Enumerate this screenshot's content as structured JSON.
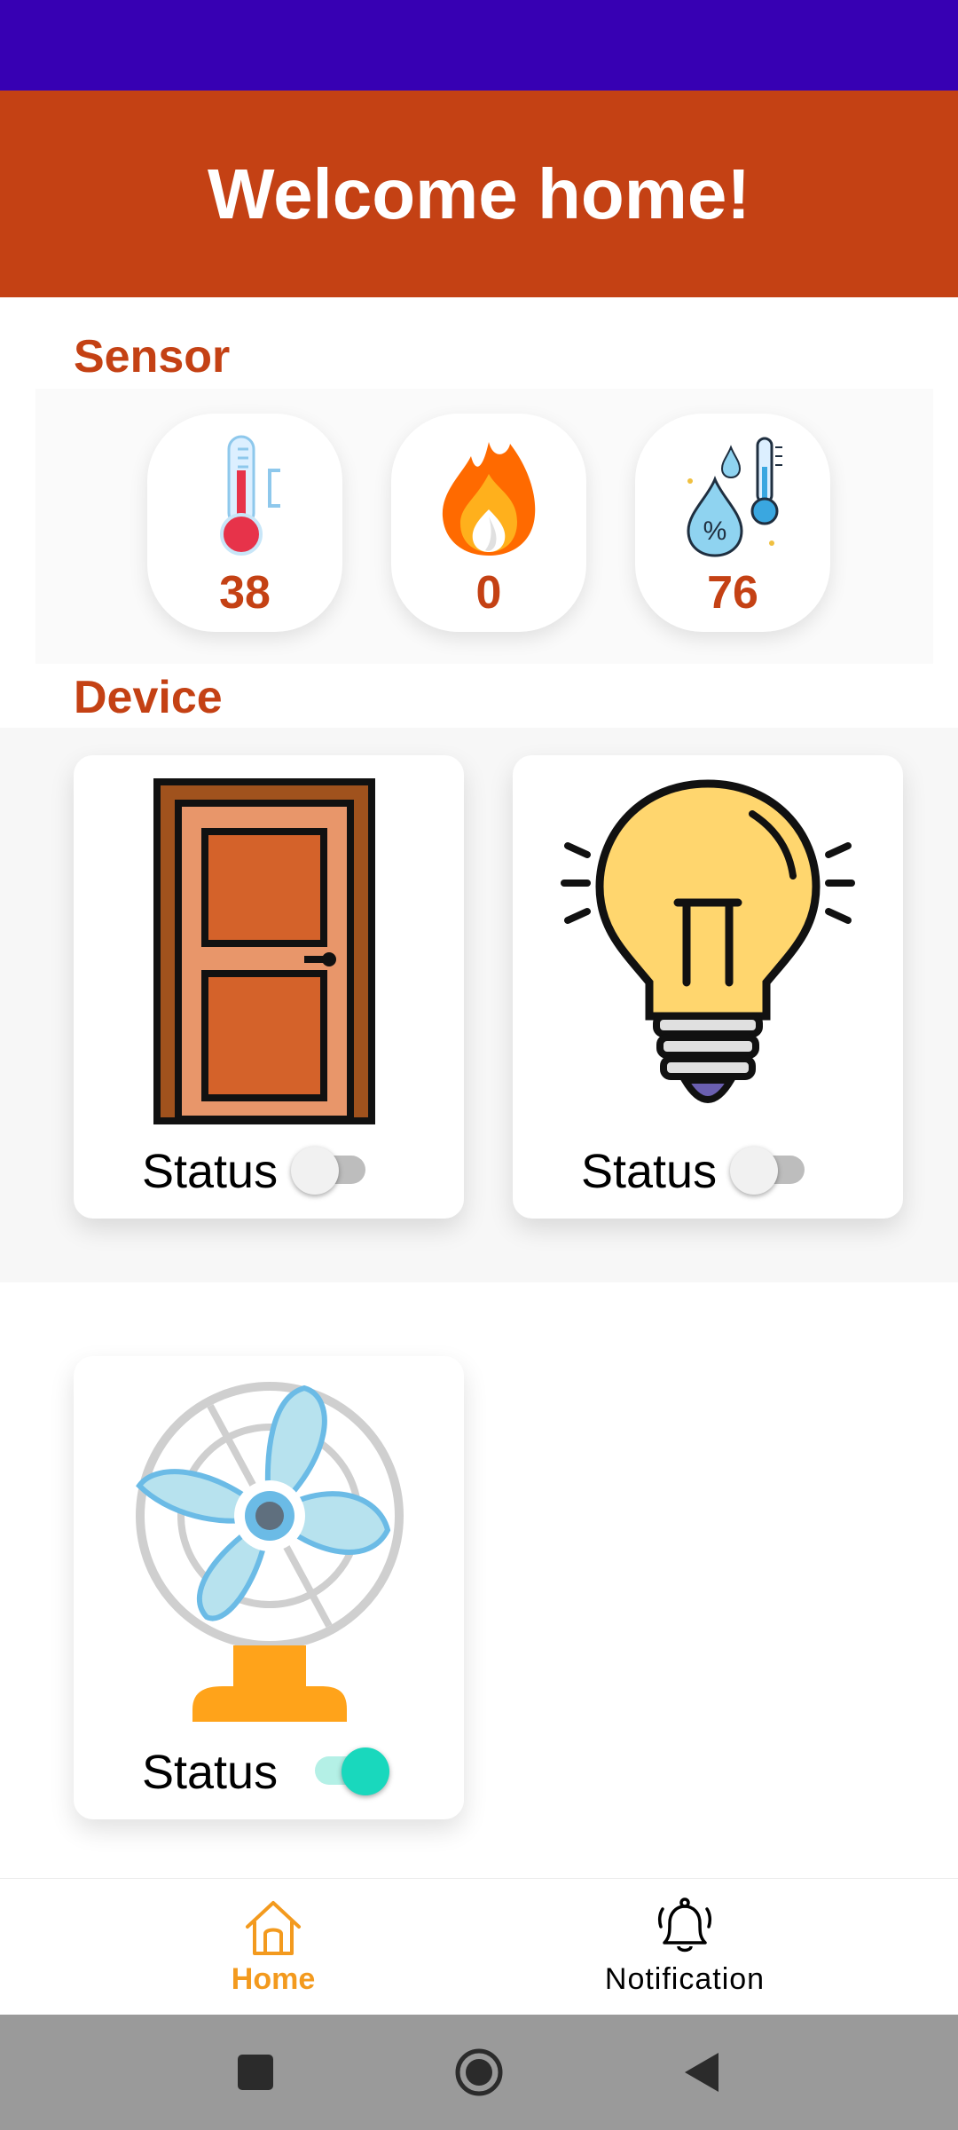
{
  "header": {
    "title": "Welcome home!"
  },
  "sensor": {
    "title": "Sensor",
    "cards": [
      {
        "icon": "thermometer-icon",
        "value": "38"
      },
      {
        "icon": "flame-icon",
        "value": "0"
      },
      {
        "icon": "humidity-icon",
        "value": "76"
      }
    ]
  },
  "device": {
    "title": "Device",
    "cards": [
      {
        "icon": "door-icon",
        "status_label": "Status",
        "on": false
      },
      {
        "icon": "light-bulb-icon",
        "status_label": "Status",
        "on": false
      },
      {
        "icon": "fan-icon",
        "status_label": "Status",
        "on": true
      }
    ]
  },
  "nav": {
    "home_label": "Home",
    "notification_label": "Notification"
  },
  "colors": {
    "status_bar": "#3700b3",
    "header": "#c44114",
    "accent_text": "#c44114",
    "nav_active": "#f39a1e",
    "switch_on": "#19d8bd"
  },
  "system_nav": [
    "square-recents-icon",
    "circle-home-icon",
    "triangle-back-icon"
  ]
}
